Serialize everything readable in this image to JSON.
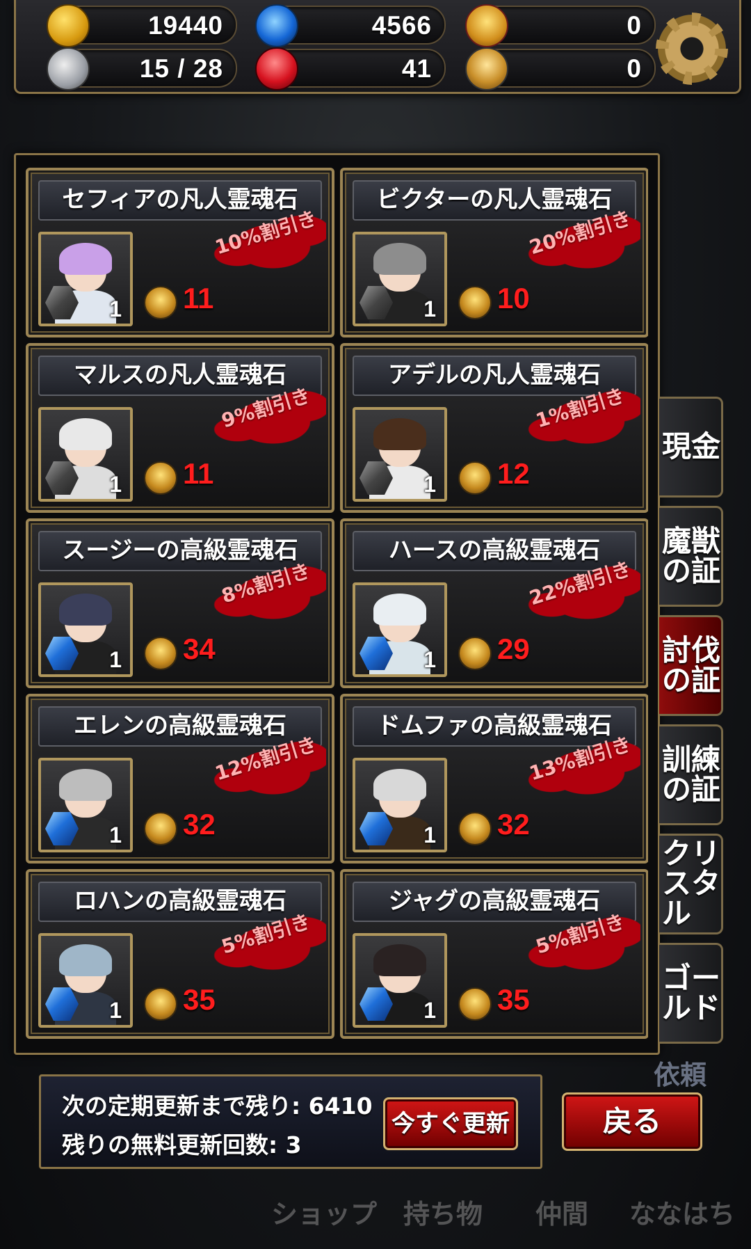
{
  "resources": [
    {
      "name": "gold-icon",
      "value": "19440",
      "style": "coin"
    },
    {
      "name": "blue-orb-icon",
      "value": "4566",
      "style": "orb"
    },
    {
      "name": "star-medal-icon",
      "value": "0",
      "style": "medal"
    },
    {
      "name": "winged-boot-icon",
      "value": "15 / 28",
      "style": "wing"
    },
    {
      "name": "red-gem-icon",
      "value": "41",
      "style": "gem"
    },
    {
      "name": "medal-coin-icon",
      "value": "0",
      "style": "medal2"
    }
  ],
  "items": [
    {
      "title": "セフィアの凡人霊魂石",
      "discount": "10%割引き",
      "qty": "1",
      "price": "11",
      "stone": "normal",
      "hair": "#c9a0e8",
      "body": "#dfe6ef"
    },
    {
      "title": "ビクターの凡人霊魂石",
      "discount": "20%割引き",
      "qty": "1",
      "price": "10",
      "stone": "normal",
      "hair": "#8d8d8d",
      "body": "#222"
    },
    {
      "title": "マルスの凡人霊魂石",
      "discount": "9%割引き",
      "qty": "1",
      "price": "11",
      "stone": "normal",
      "hair": "#e8e8e8",
      "body": "#ddd"
    },
    {
      "title": "アデルの凡人霊魂石",
      "discount": "1%割引き",
      "qty": "1",
      "price": "12",
      "stone": "normal",
      "hair": "#4a2e1c",
      "body": "#eaeaea"
    },
    {
      "title": "スージーの高級霊魂石",
      "discount": "8%割引き",
      "qty": "1",
      "price": "34",
      "stone": "high",
      "hair": "#3b3f5a",
      "body": "#202020"
    },
    {
      "title": "ハースの高級霊魂石",
      "discount": "22%割引き",
      "qty": "1",
      "price": "29",
      "stone": "high",
      "hair": "#e9eef2",
      "body": "#d9e4ea"
    },
    {
      "title": "エレンの高級霊魂石",
      "discount": "12%割引き",
      "qty": "1",
      "price": "32",
      "stone": "high",
      "hair": "#bdbdbd",
      "body": "#2a2a2a"
    },
    {
      "title": "ドムファの高級霊魂石",
      "discount": "13%割引き",
      "qty": "1",
      "price": "32",
      "stone": "high",
      "hair": "#d8d8d8",
      "body": "#3a2a1a"
    },
    {
      "title": "ロハンの高級霊魂石",
      "discount": "5%割引き",
      "qty": "1",
      "price": "35",
      "stone": "high",
      "hair": "#9fb6c8",
      "body": "#2e3644"
    },
    {
      "title": "ジャグの高級霊魂石",
      "discount": "5%割引き",
      "qty": "1",
      "price": "35",
      "stone": "high",
      "hair": "#2a2222",
      "body": "#1a1a1a"
    }
  ],
  "tabs": [
    {
      "label": "現金",
      "active": false
    },
    {
      "label": "魔獣\nの証",
      "active": false
    },
    {
      "label": "討伐\nの証",
      "active": true
    },
    {
      "label": "訓練\nの証",
      "active": false
    },
    {
      "label": "クリ\nスタ\nル",
      "active": false
    },
    {
      "label": "ゴー\nルド",
      "active": false
    }
  ],
  "footer": {
    "refresh_line": "次の定期更新まで残り: 6410",
    "free_line": "残りの無料更新回数: 3",
    "refresh_now": "今すぐ更新",
    "back": "戻る"
  },
  "background_labels": {
    "irai": "依頼",
    "nav": [
      "ショップ",
      "持ち物",
      "仲間",
      "ななはち"
    ]
  },
  "colors": {
    "accent": "#d21616",
    "price": "#ff1d1d",
    "frame": "#9c8554"
  }
}
